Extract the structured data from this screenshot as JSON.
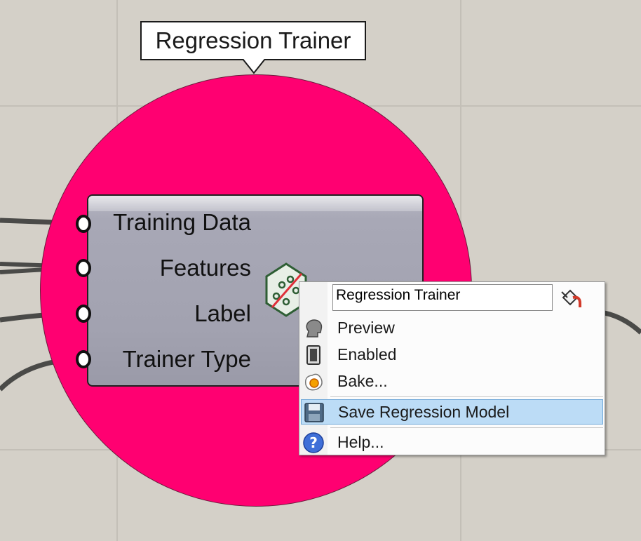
{
  "canvas": {
    "background": "#d4d0c8",
    "blob_color": "#ff0071"
  },
  "tooltip": {
    "text": "Regression Trainer"
  },
  "component": {
    "inputs": [
      {
        "label": "Training Data"
      },
      {
        "label": "Features"
      },
      {
        "label": "Label"
      },
      {
        "label": "Trainer Type"
      }
    ],
    "icon": "regression-trainer-icon"
  },
  "context_menu": {
    "name_value": "Regression Trainer",
    "name_icon": "paint-bucket-icon",
    "items": [
      {
        "label": "Preview",
        "icon": "preview-head-icon"
      },
      {
        "label": "Enabled",
        "icon": "enabled-switch-icon"
      },
      {
        "label": "Bake...",
        "icon": "bake-egg-icon"
      },
      {
        "label": "Save Regression Model",
        "icon": "save-disk-icon",
        "highlighted": true
      },
      {
        "label": "Help...",
        "icon": "help-icon"
      }
    ]
  }
}
